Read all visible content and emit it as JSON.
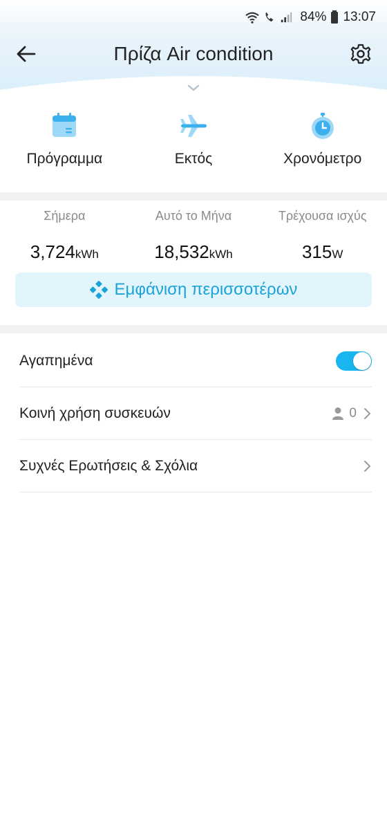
{
  "status_bar": {
    "battery": "84%",
    "time": "13:07"
  },
  "header": {
    "title": "Πρίζα Air condition"
  },
  "features": [
    {
      "label": "Πρόγραμμα",
      "icon": "calendar-icon"
    },
    {
      "label": "Εκτός",
      "icon": "airplane-icon"
    },
    {
      "label": "Χρονόμετρο",
      "icon": "stopwatch-icon"
    }
  ],
  "stats": [
    {
      "label": "Σήμερα",
      "value": "3,724",
      "unit": "kWh"
    },
    {
      "label": "Αυτό το Μήνα",
      "value": "18,532",
      "unit": "kWh"
    },
    {
      "label": "Τρέχουσα ισχύς",
      "value": "315",
      "unit": "W"
    }
  ],
  "show_more": {
    "label": "Εμφάνιση περισσοτέρων"
  },
  "list": {
    "favorites": {
      "label": "Αγαπημένα",
      "enabled": true
    },
    "sharing": {
      "label": "Κοινή χρήση συσκευών",
      "count": "0"
    },
    "faq": {
      "label": "Συχνές Ερωτήσεις & Σχόλια"
    }
  },
  "colors": {
    "accent": "#19b5ef",
    "accent_text": "#1aa3d6",
    "button_bg": "#e3f5fc"
  }
}
